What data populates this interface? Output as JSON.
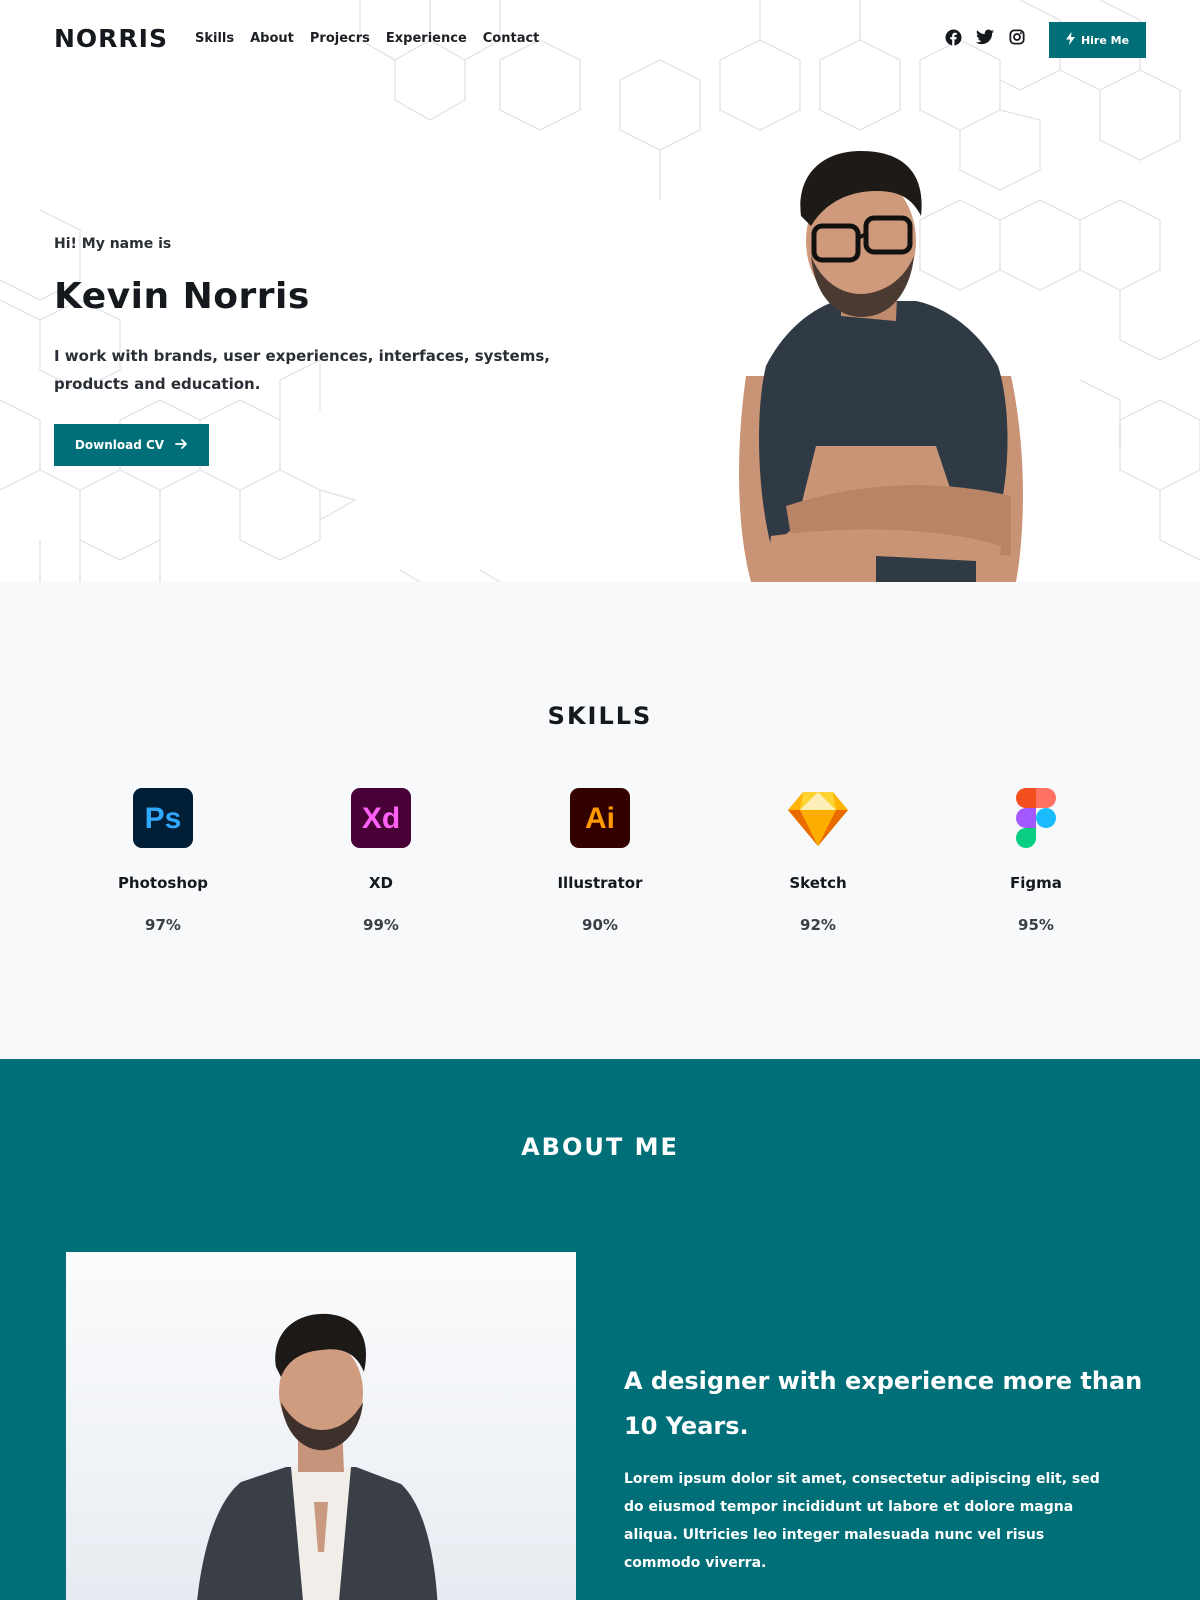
{
  "header": {
    "logo": "NORRIS",
    "nav": [
      "Skills",
      "About",
      "Projecrs",
      "Experience",
      "Contact"
    ],
    "socials": [
      "facebook-icon",
      "twitter-icon",
      "instagram-icon"
    ],
    "hire_label": "Hire Me"
  },
  "hero": {
    "greeting": "Hi! My name is",
    "name": "Kevin Norris",
    "description": "I work with brands, user experiences, interfaces, systems, products and education.",
    "cta_label": "Download CV"
  },
  "skills": {
    "title": "SKILLS",
    "items": [
      {
        "name": "Photoshop",
        "percent": "97%",
        "icon": "photoshop-icon"
      },
      {
        "name": "XD",
        "percent": "99%",
        "icon": "xd-icon"
      },
      {
        "name": "Illustrator",
        "percent": "90%",
        "icon": "illustrator-icon"
      },
      {
        "name": "Sketch",
        "percent": "92%",
        "icon": "sketch-icon"
      },
      {
        "name": "Figma",
        "percent": "95%",
        "icon": "figma-icon"
      }
    ]
  },
  "about": {
    "title": "ABOUT ME",
    "heading": "A designer with experience more than 10 Years.",
    "text": "Lorem ipsum dolor sit amet, consectetur adipiscing elit, sed do eiusmod tempor incididunt ut labore et dolore magna aliqua. Ultricies leo integer malesuada nunc vel risus commodo viverra."
  },
  "colors": {
    "accent": "#006f78",
    "dark": "#15181d",
    "skills_bg": "#f8f9fb"
  }
}
